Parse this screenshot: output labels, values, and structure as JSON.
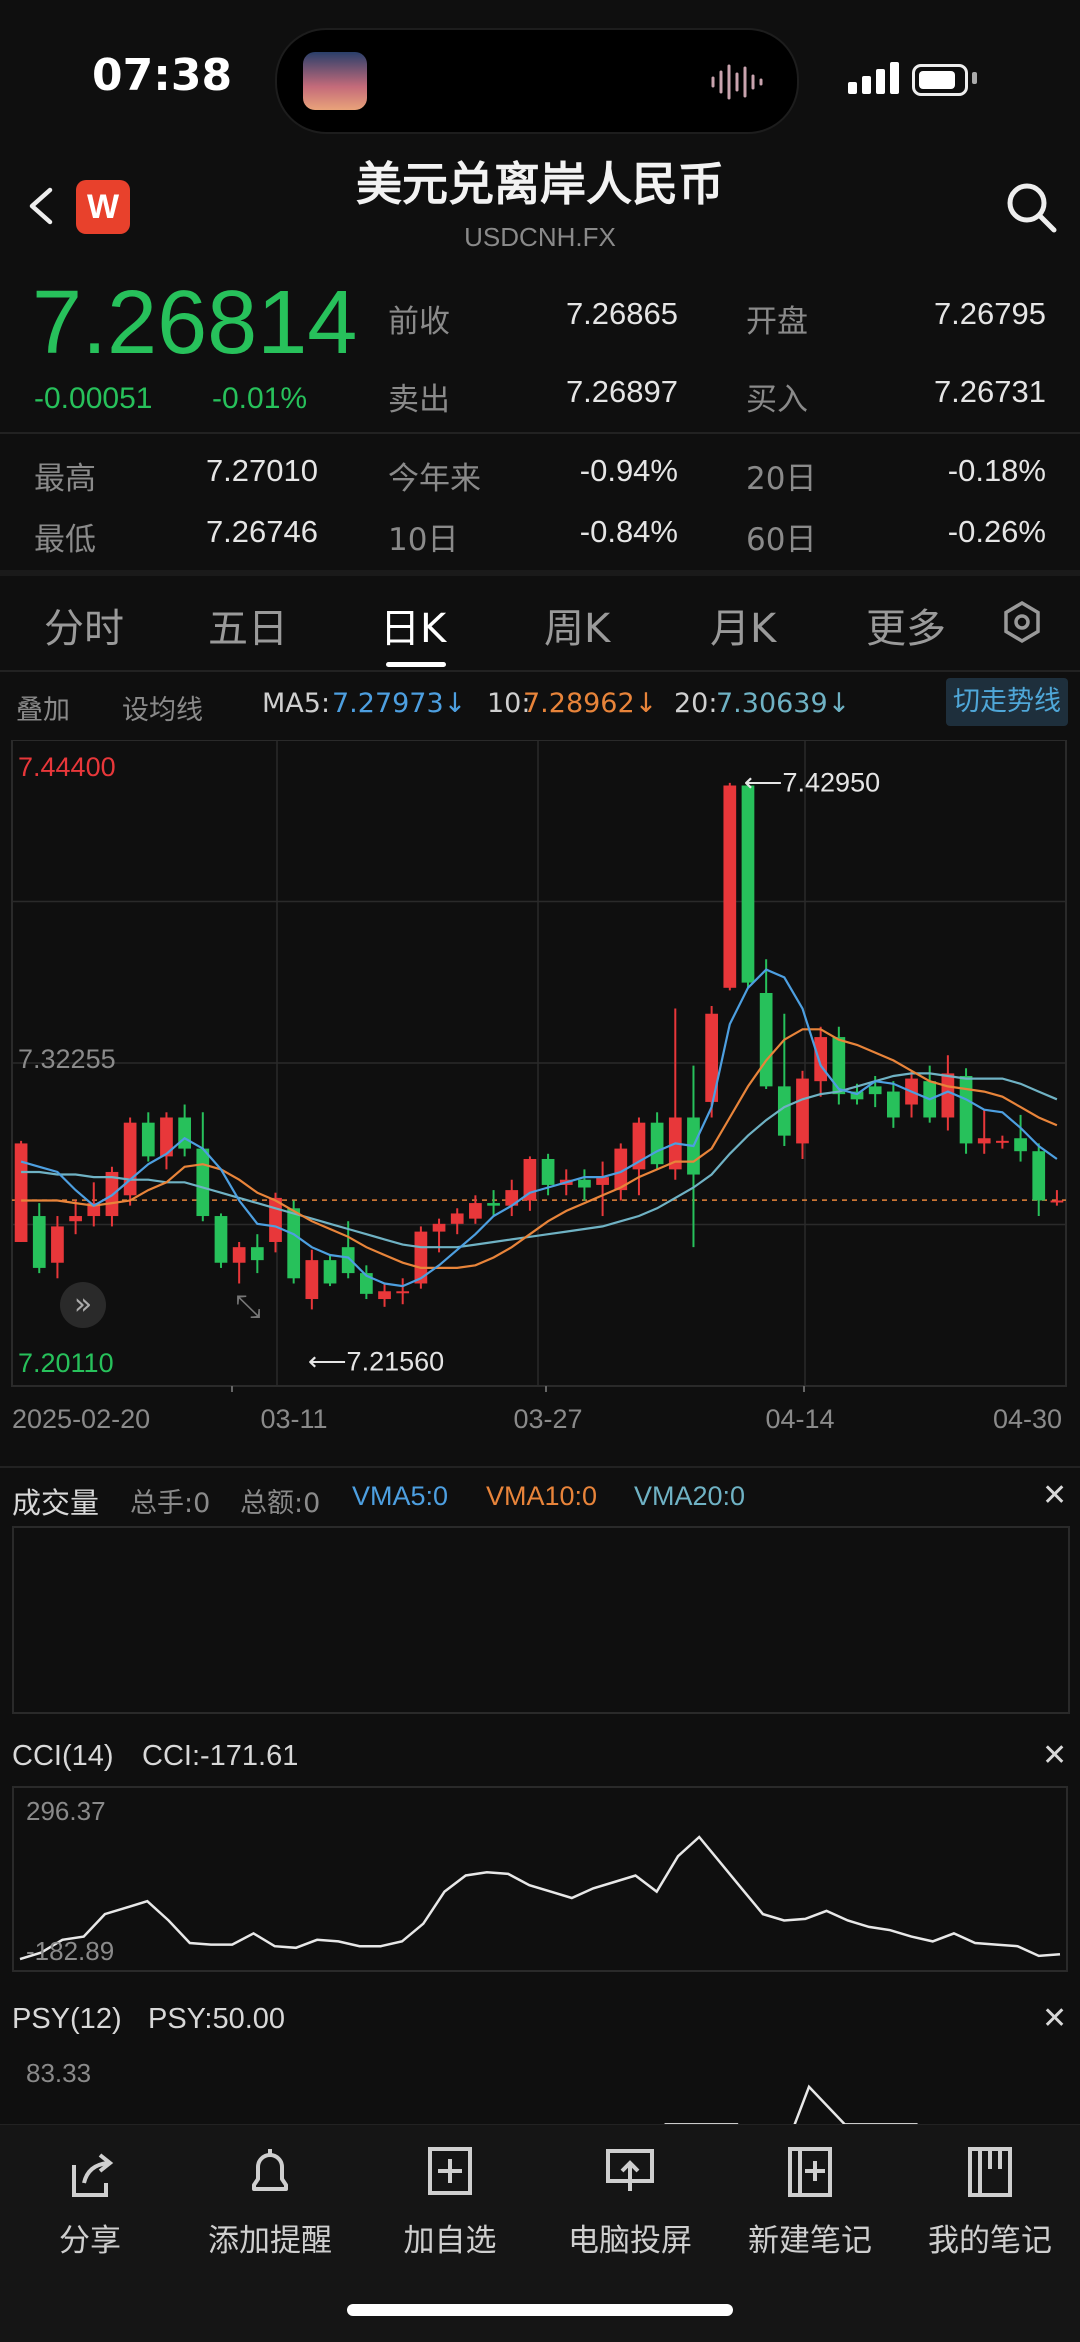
{
  "status_bar": {
    "time": "07:38"
  },
  "header": {
    "logo": "W",
    "title": "美元兑离岸人民币",
    "subtitle": "USDCNH.FX"
  },
  "quote": {
    "price": "7.26814",
    "change": "-0.00051",
    "change_pct": "-0.01%",
    "fields": [
      {
        "label": "前收",
        "value": "7.26865"
      },
      {
        "label": "开盘",
        "value": "7.26795"
      },
      {
        "label": "卖出",
        "value": "7.26897"
      },
      {
        "label": "买入",
        "value": "7.26731"
      }
    ],
    "stats": [
      {
        "label": "最高",
        "value": "7.27010"
      },
      {
        "label": "今年来",
        "value": "-0.94%"
      },
      {
        "label": "20日",
        "value": "-0.18%"
      },
      {
        "label": "最低",
        "value": "7.26746"
      },
      {
        "label": "10日",
        "value": "-0.84%"
      },
      {
        "label": "60日",
        "value": "-0.26%"
      }
    ]
  },
  "tabs": [
    "分时",
    "五日",
    "日K",
    "周K",
    "月K",
    "更多"
  ],
  "ma_row": {
    "overlay": "叠加",
    "set_ma": "设均线",
    "ma5_label": "MA5:",
    "ma5": "7.27973↓",
    "ma10_label": "10:",
    "ma10": "7.28962↓",
    "ma20_label": "20:",
    "ma20": "7.30639↓",
    "trend_button": "切走势线"
  },
  "colors": {
    "up": "#e8373a",
    "down": "#27c15b",
    "ma5": "#4d9fe0",
    "ma10": "#e8843a",
    "ma20": "#6fb2c4"
  },
  "chart_data": {
    "type": "candlestick",
    "y_max_label": "7.44400",
    "y_mid_label": "7.32255",
    "y_min_label": "7.20110",
    "ylim": [
      7.2011,
      7.444
    ],
    "high_annotation": "7.42950",
    "low_annotation": "7.21560",
    "x_labels": [
      "2025-02-20",
      "03-11",
      "03-27",
      "04-14",
      "04-30"
    ],
    "last_price": 7.26814,
    "candles": [
      {
        "o": 7.252,
        "h": 7.291,
        "l": 7.252,
        "c": 7.29
      },
      {
        "o": 7.262,
        "h": 7.267,
        "l": 7.24,
        "c": 7.242
      },
      {
        "o": 7.244,
        "h": 7.262,
        "l": 7.238,
        "c": 7.258
      },
      {
        "o": 7.26,
        "h": 7.268,
        "l": 7.255,
        "c": 7.262
      },
      {
        "o": 7.262,
        "h": 7.275,
        "l": 7.258,
        "c": 7.267
      },
      {
        "o": 7.262,
        "h": 7.281,
        "l": 7.258,
        "c": 7.279
      },
      {
        "o": 7.27,
        "h": 7.3,
        "l": 7.266,
        "c": 7.298
      },
      {
        "o": 7.298,
        "h": 7.302,
        "l": 7.283,
        "c": 7.285
      },
      {
        "o": 7.285,
        "h": 7.302,
        "l": 7.28,
        "c": 7.3
      },
      {
        "o": 7.3,
        "h": 7.305,
        "l": 7.285,
        "c": 7.288
      },
      {
        "o": 7.288,
        "h": 7.302,
        "l": 7.26,
        "c": 7.262
      },
      {
        "o": 7.262,
        "h": 7.263,
        "l": 7.242,
        "c": 7.244
      },
      {
        "o": 7.244,
        "h": 7.252,
        "l": 7.236,
        "c": 7.25
      },
      {
        "o": 7.25,
        "h": 7.255,
        "l": 7.24,
        "c": 7.245
      },
      {
        "o": 7.252,
        "h": 7.271,
        "l": 7.248,
        "c": 7.269
      },
      {
        "o": 7.265,
        "h": 7.268,
        "l": 7.236,
        "c": 7.238
      },
      {
        "o": 7.23,
        "h": 7.249,
        "l": 7.226,
        "c": 7.245
      },
      {
        "o": 7.245,
        "h": 7.247,
        "l": 7.235,
        "c": 7.236
      },
      {
        "o": 7.25,
        "h": 7.26,
        "l": 7.238,
        "c": 7.24
      },
      {
        "o": 7.24,
        "h": 7.243,
        "l": 7.23,
        "c": 7.232
      },
      {
        "o": 7.23,
        "h": 7.236,
        "l": 7.227,
        "c": 7.233
      },
      {
        "o": 7.233,
        "h": 7.238,
        "l": 7.228,
        "c": 7.233
      },
      {
        "o": 7.236,
        "h": 7.258,
        "l": 7.234,
        "c": 7.256
      },
      {
        "o": 7.256,
        "h": 7.261,
        "l": 7.248,
        "c": 7.259
      },
      {
        "o": 7.259,
        "h": 7.265,
        "l": 7.255,
        "c": 7.263
      },
      {
        "o": 7.261,
        "h": 7.27,
        "l": 7.259,
        "c": 7.267
      },
      {
        "o": 7.267,
        "h": 7.272,
        "l": 7.262,
        "c": 7.266
      },
      {
        "o": 7.266,
        "h": 7.276,
        "l": 7.262,
        "c": 7.272
      },
      {
        "o": 7.268,
        "h": 7.285,
        "l": 7.264,
        "c": 7.284
      },
      {
        "o": 7.284,
        "h": 7.286,
        "l": 7.27,
        "c": 7.274
      },
      {
        "o": 7.274,
        "h": 7.28,
        "l": 7.27,
        "c": 7.276
      },
      {
        "o": 7.276,
        "h": 7.28,
        "l": 7.268,
        "c": 7.273
      },
      {
        "o": 7.274,
        "h": 7.283,
        "l": 7.262,
        "c": 7.277
      },
      {
        "o": 7.272,
        "h": 7.29,
        "l": 7.268,
        "c": 7.288
      },
      {
        "o": 7.28,
        "h": 7.3,
        "l": 7.27,
        "c": 7.298
      },
      {
        "o": 7.298,
        "h": 7.302,
        "l": 7.28,
        "c": 7.282
      },
      {
        "o": 7.28,
        "h": 7.342,
        "l": 7.276,
        "c": 7.3
      },
      {
        "o": 7.3,
        "h": 7.32,
        "l": 7.25,
        "c": 7.278
      },
      {
        "o": 7.306,
        "h": 7.343,
        "l": 7.3,
        "c": 7.34
      },
      {
        "o": 7.35,
        "h": 7.429,
        "l": 7.349,
        "c": 7.428
      },
      {
        "o": 7.428,
        "h": 7.429,
        "l": 7.35,
        "c": 7.352
      },
      {
        "o": 7.348,
        "h": 7.361,
        "l": 7.311,
        "c": 7.312
      },
      {
        "o": 7.312,
        "h": 7.34,
        "l": 7.289,
        "c": 7.293
      },
      {
        "o": 7.29,
        "h": 7.318,
        "l": 7.284,
        "c": 7.315
      },
      {
        "o": 7.314,
        "h": 7.335,
        "l": 7.308,
        "c": 7.331
      },
      {
        "o": 7.331,
        "h": 7.335,
        "l": 7.305,
        "c": 7.309
      },
      {
        "o": 7.31,
        "h": 7.313,
        "l": 7.305,
        "c": 7.307
      },
      {
        "o": 7.312,
        "h": 7.316,
        "l": 7.304,
        "c": 7.309
      },
      {
        "o": 7.31,
        "h": 7.314,
        "l": 7.296,
        "c": 7.3
      },
      {
        "o": 7.305,
        "h": 7.318,
        "l": 7.3,
        "c": 7.315
      },
      {
        "o": 7.314,
        "h": 7.32,
        "l": 7.298,
        "c": 7.3
      },
      {
        "o": 7.3,
        "h": 7.324,
        "l": 7.295,
        "c": 7.317
      },
      {
        "o": 7.316,
        "h": 7.319,
        "l": 7.286,
        "c": 7.29
      },
      {
        "o": 7.29,
        "h": 7.303,
        "l": 7.286,
        "c": 7.292
      },
      {
        "o": 7.291,
        "h": 7.293,
        "l": 7.288,
        "c": 7.291
      },
      {
        "o": 7.292,
        "h": 7.301,
        "l": 7.283,
        "c": 7.287
      },
      {
        "o": 7.287,
        "h": 7.29,
        "l": 7.262,
        "c": 7.268
      },
      {
        "o": 7.268,
        "h": 7.272,
        "l": 7.266,
        "c": 7.268
      }
    ],
    "ma5": [
      7.283,
      7.281,
      7.279,
      7.272,
      7.266,
      7.27,
      7.276,
      7.282,
      7.286,
      7.292,
      7.288,
      7.28,
      7.268,
      7.259,
      7.258,
      7.255,
      7.25,
      7.247,
      7.246,
      7.239,
      7.236,
      7.235,
      7.238,
      7.243,
      7.249,
      7.255,
      7.262,
      7.266,
      7.271,
      7.273,
      7.275,
      7.277,
      7.277,
      7.279,
      7.283,
      7.287,
      7.29,
      7.289,
      7.304,
      7.336,
      7.35,
      7.357,
      7.354,
      7.342,
      7.32,
      7.311,
      7.309,
      7.314,
      7.313,
      7.31,
      7.307,
      7.31,
      7.307,
      7.303,
      7.302,
      7.296,
      7.289,
      7.284
    ],
    "ma10": [
      7.268,
      7.268,
      7.268,
      7.267,
      7.266,
      7.267,
      7.268,
      7.272,
      7.275,
      7.281,
      7.282,
      7.28,
      7.276,
      7.271,
      7.268,
      7.264,
      7.26,
      7.257,
      7.254,
      7.25,
      7.247,
      7.244,
      7.242,
      7.242,
      7.242,
      7.243,
      7.246,
      7.25,
      7.255,
      7.26,
      7.264,
      7.267,
      7.27,
      7.273,
      7.277,
      7.28,
      7.283,
      7.283,
      7.288,
      7.3,
      7.312,
      7.322,
      7.33,
      7.334,
      7.334,
      7.33,
      7.328,
      7.325,
      7.322,
      7.318,
      7.314,
      7.312,
      7.311,
      7.31,
      7.308,
      7.304,
      7.3,
      7.297
    ],
    "ma20": [
      7.279,
      7.279,
      7.278,
      7.278,
      7.277,
      7.277,
      7.276,
      7.276,
      7.275,
      7.275,
      7.273,
      7.271,
      7.269,
      7.267,
      7.265,
      7.263,
      7.261,
      7.259,
      7.257,
      7.255,
      7.253,
      7.251,
      7.25,
      7.25,
      7.25,
      7.251,
      7.252,
      7.253,
      7.254,
      7.255,
      7.256,
      7.257,
      7.258,
      7.26,
      7.262,
      7.265,
      7.269,
      7.273,
      7.278,
      7.286,
      7.293,
      7.299,
      7.304,
      7.307,
      7.309,
      7.31,
      7.312,
      7.314,
      7.316,
      7.317,
      7.317,
      7.316,
      7.315,
      7.315,
      7.315,
      7.313,
      7.31,
      7.307
    ]
  },
  "volume": {
    "title": "成交量",
    "total_hands": "总手:0",
    "total_amount": "总额:0",
    "vma5": "VMA5:0",
    "vma10": "VMA10:0",
    "vma20": "VMA20:0"
  },
  "cci": {
    "title": "CCI(14)",
    "value": "CCI:-171.61",
    "max_label": "296.37",
    "min_label": "-182.89",
    "ylim": [
      -182.89,
      296.37
    ],
    "values": [
      -180,
      -160,
      -120,
      -110,
      -40,
      -20,
      0,
      -60,
      -130,
      -135,
      -135,
      -100,
      -140,
      -145,
      -120,
      -125,
      -140,
      -140,
      -125,
      -70,
      30,
      80,
      90,
      85,
      50,
      30,
      10,
      40,
      60,
      80,
      30,
      140,
      200,
      120,
      40,
      -40,
      -60,
      -55,
      -30,
      -60,
      -80,
      -90,
      -110,
      -125,
      -100,
      -130,
      -135,
      -140,
      -170,
      -165
    ]
  },
  "psy": {
    "title": "PSY(12)",
    "value": "PSY:50.00",
    "max_label": "83.33",
    "ylim": [
      40,
      90
    ],
    "values": [
      50,
      50,
      50,
      60,
      60,
      60,
      60,
      58,
      60,
      50,
      50,
      50,
      55,
      55,
      55,
      55,
      55,
      60,
      75,
      75,
      75,
      60,
      85,
      75,
      75,
      75,
      60,
      50,
      50,
      50
    ]
  },
  "bottom_nav": [
    {
      "label": "分享"
    },
    {
      "label": "添加提醒"
    },
    {
      "label": "加自选"
    },
    {
      "label": "电脑投屏"
    },
    {
      "label": "新建笔记"
    },
    {
      "label": "我的笔记"
    }
  ]
}
